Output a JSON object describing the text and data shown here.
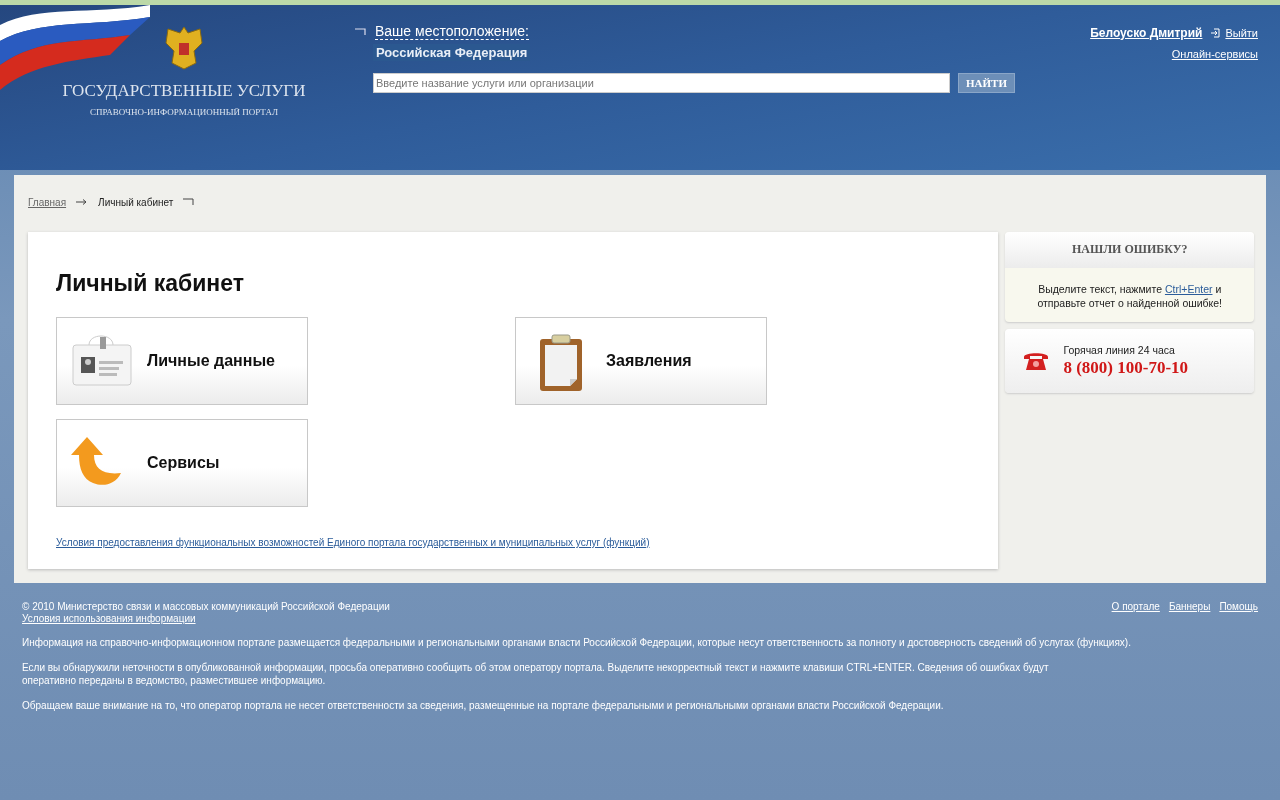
{
  "header": {
    "title": "ГОСУДАРСТВЕННЫЕ УСЛУГИ",
    "subtitle": "СПРАВОЧНО-ИНФОРМАЦИОННЫЙ ПОРТАЛ",
    "location_label": "Ваше местоположение:",
    "location_value": "Российская Федерация",
    "search": {
      "placeholder": "Введите название услуги или организации"
    },
    "search_button": "НАЙТИ",
    "user_name": "Белоуско Дмитрий",
    "logout": "Выйти",
    "online_services": "Онлайн-сервисы"
  },
  "breadcrumb": [
    {
      "label": "Главная",
      "kind": "link"
    },
    {
      "label": "Личный кабинет",
      "kind": "current"
    }
  ],
  "main": {
    "title": "Личный кабинет",
    "tiles": [
      {
        "label": "Личные данные",
        "kind": "badge"
      },
      {
        "label": "Заявления",
        "kind": "clipboard"
      },
      {
        "label": "Сервисы",
        "kind": "arrow"
      }
    ],
    "terms_link": "Условия предоставления функциональных возможностей Единого портала государственных и муниципальных услуг (функций)"
  },
  "sidebar": {
    "error_title": "НАШЛИ ОШИБКУ?",
    "error_text_before": "Выделите текст, нажмите ",
    "error_link": "Ctrl+Enter",
    "error_text_after": " и отправьте отчет о найденной ошибке!",
    "hotline_label": "Горячая линия 24 часа",
    "hotline_phone": "8 (800) 100-70-10"
  },
  "footer": {
    "copyright": "© 2010 Министерство связи и массовых коммуникаций Российской Федерации",
    "terms_link": "Условия использования информации",
    "links": [
      "О портале",
      "Баннеры",
      "Помощь"
    ],
    "paragraphs": [
      "Информация на справочно-информационном портале размещается федеральными и региональными органами власти Российской Федерации, которые несут ответственность за полноту и достоверность сведений об услугах (функциях).",
      "Если вы обнаружили неточности в опубликованной информации, просьба оперативно сообщить об этом оператору портала. Выделите некорректный текст и нажмите клавиши CTRL+ENTER. Сведения об ошибках будут оперативно переданы в ведомство, разместившее информацию.",
      "Обращаем ваше внимание на то, что оператор портала не несет ответственности за сведения, размещенные на портале федеральными и региональными органами власти Российской Федерации."
    ]
  }
}
